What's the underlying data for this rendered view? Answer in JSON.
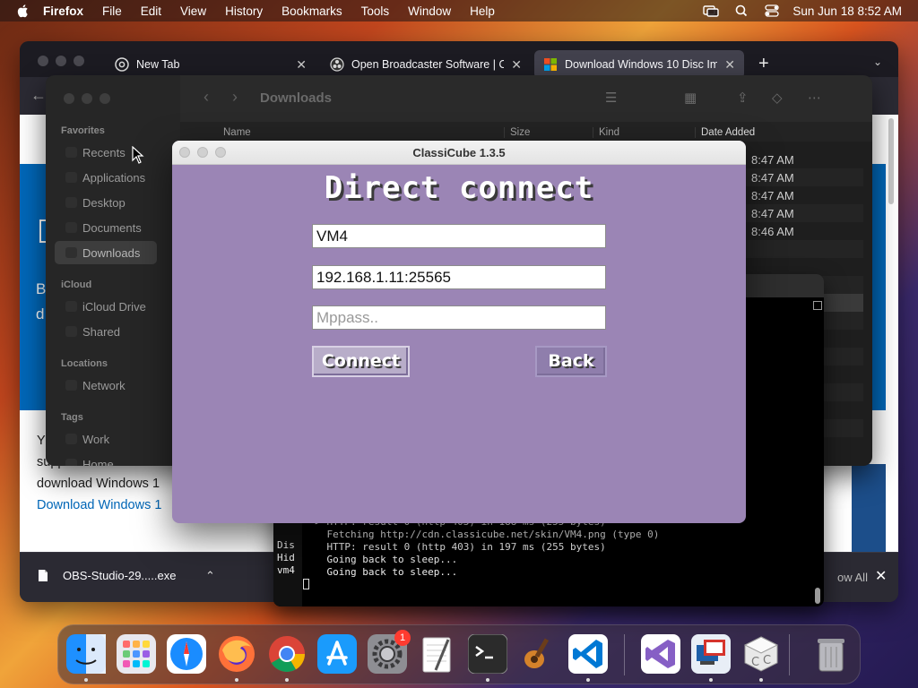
{
  "menubar": {
    "app_name": "Firefox",
    "menus": [
      "File",
      "Edit",
      "View",
      "History",
      "Bookmarks",
      "Tools",
      "Window",
      "Help"
    ],
    "clock": "Sun Jun 18  8:52 AM",
    "status_icons": [
      "screen-mirroring-icon",
      "search-icon",
      "control-center-icon"
    ]
  },
  "firefox": {
    "tabs": [
      {
        "title": "New Tab",
        "icon": "chrome-icon"
      },
      {
        "title": "Open Broadcaster Software | O",
        "icon": "obs-icon"
      },
      {
        "title": "Download Windows 10 Disc Im",
        "icon": "microsoft-icon"
      }
    ],
    "page": {
      "blue_text_1": "B",
      "blue_text_2": "d",
      "text_line_1": "Y",
      "text_line_2": "support the Windows",
      "text_line_3": "download Windows 1",
      "link": "Download Windows 1"
    },
    "downloads": {
      "file": "OBS-Studio-29.....exe",
      "show_all": "ow All"
    }
  },
  "finder": {
    "title": "Downloads",
    "sidebar": {
      "favorites_header": "Favorites",
      "favorites": [
        "Recents",
        "Applications",
        "Desktop",
        "Documents",
        "Downloads"
      ],
      "icloud_header": "iCloud",
      "icloud": [
        "iCloud Drive",
        "Shared"
      ],
      "locations_header": "Locations",
      "locations": [
        "Network"
      ],
      "tags_header": "Tags",
      "tags": [
        "Work",
        "Home"
      ]
    },
    "columns": {
      "name": "Name",
      "size": "Size",
      "kind": "Kind",
      "date": "Date Added"
    },
    "dates": [
      "8:47 AM",
      "8:47 AM",
      "8:47 AM",
      "8:47 AM",
      "8:46 AM"
    ]
  },
  "terminal": {
    "side_fragments": [
      "Dis",
      "Hid",
      "vm4"
    ],
    "lines": [
      "==> HTTP: result 0 (http 403) in 188 ms (255 bytes)",
      "    Fetching http://cdn.classicube.net/skin/VM4.png (type 0)",
      "    HTTP: result 0 (http 403) in 197 ms (255 bytes)",
      "    Going back to sleep...",
      "    Going back to sleep..."
    ]
  },
  "classicube": {
    "window_title": "ClassiCube 1.3.5",
    "heading": "Direct connect",
    "username_value": "VM4",
    "address_value": "192.168.1.11:25565",
    "mppass_placeholder": "Mppass..",
    "connect_label": "Connect",
    "back_label": "Back"
  },
  "dock": {
    "apps": [
      "Finder",
      "Launchpad",
      "Safari",
      "Firefox",
      "Google Chrome",
      "App Store",
      "System Settings",
      "TextEdit",
      "Terminal",
      "GarageBand",
      "Visual Studio Code",
      "Visual Studio",
      "Remote Desktop",
      "ClassiCube",
      "Trash"
    ],
    "settings_badge": "1"
  }
}
